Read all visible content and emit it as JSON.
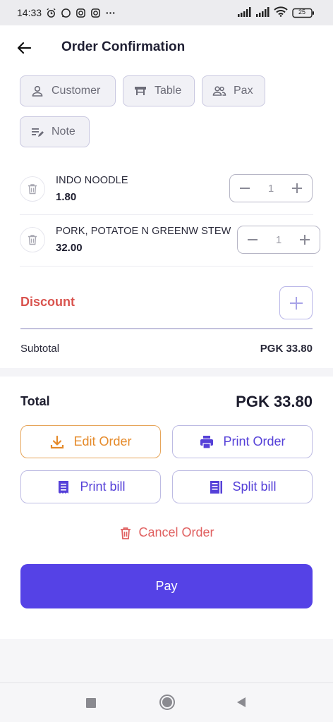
{
  "status_bar": {
    "time": "14:33",
    "left_icons": [
      "alarm-icon",
      "whatsapp-icon",
      "instagram-icon",
      "instagram-icon",
      "more-icon"
    ],
    "right_icons": [
      "signal-icon",
      "signal-icon",
      "wifi-icon",
      "battery-icon"
    ],
    "battery_level": "25"
  },
  "header": {
    "title": "Order Confirmation",
    "back_icon": "arrow-left-icon"
  },
  "chips": [
    {
      "label": "Customer",
      "icon": "person-icon"
    },
    {
      "label": "Table",
      "icon": "table-icon"
    },
    {
      "label": "Pax",
      "icon": "people-icon"
    },
    {
      "label": "Note",
      "icon": "note-edit-icon"
    }
  ],
  "order_items": [
    {
      "name": "INDO NOODLE",
      "price": "1.80",
      "qty": "1"
    },
    {
      "name": "PORK, POTATOE N GREENW STEW",
      "price": "32.00",
      "qty": "1"
    }
  ],
  "discount": {
    "label": "Discount"
  },
  "subtotal": {
    "label": "Subtotal",
    "value": "PGK 33.80"
  },
  "total": {
    "label": "Total",
    "value": "PGK 33.80"
  },
  "actions": {
    "edit_order": "Edit Order",
    "print_order": "Print Order",
    "print_bill": "Print bill",
    "split_bill": "Split bill",
    "cancel_order": "Cancel Order",
    "pay": "Pay"
  },
  "colors": {
    "accent": "#5542e6",
    "discount": "#d9544f",
    "edit": "#e58a2a",
    "cancel": "#e06060"
  }
}
